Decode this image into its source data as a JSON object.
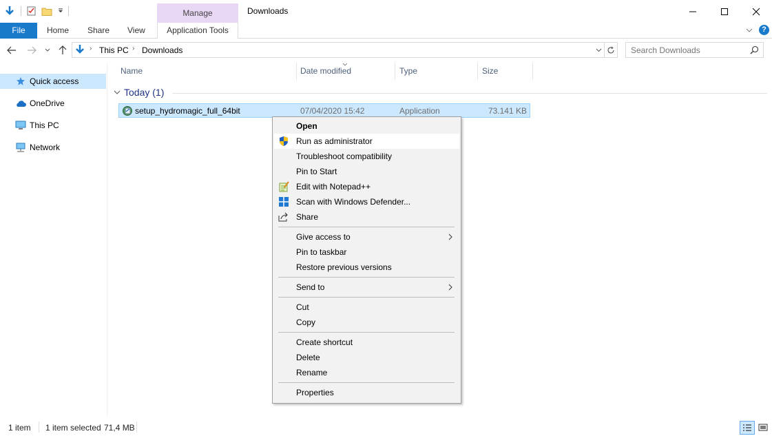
{
  "titlebar": {
    "manage_label": "Manage",
    "title": "Downloads",
    "minimize": "─",
    "maximize": "☐",
    "close": "✕"
  },
  "ribbon": {
    "file": "File",
    "home": "Home",
    "share": "Share",
    "view": "View",
    "app_tools": "Application Tools",
    "help": "?"
  },
  "address": {
    "crumbs": [
      "This PC",
      "Downloads"
    ],
    "search_placeholder": "Search Downloads"
  },
  "nav": {
    "items": [
      {
        "label": "Quick access",
        "icon": "star-icon"
      },
      {
        "label": "OneDrive",
        "icon": "cloud-icon"
      },
      {
        "label": "This PC",
        "icon": "computer-icon"
      },
      {
        "label": "Network",
        "icon": "network-icon"
      }
    ]
  },
  "columns": [
    "Name",
    "Date modified",
    "Type",
    "Size"
  ],
  "group": {
    "label": "Today (1)"
  },
  "file": {
    "name": "setup_hydromagic_full_64bit",
    "date": "07/04/2020 15:42",
    "type": "Application",
    "size": "73.141 KB"
  },
  "context_menu": {
    "items": [
      {
        "label": "Open",
        "bold": true
      },
      {
        "label": "Run as administrator",
        "icon": "uac-shield-icon",
        "highlighted": true
      },
      {
        "label": "Troubleshoot compatibility"
      },
      {
        "label": "Pin to Start"
      },
      {
        "label": "Edit with Notepad++",
        "icon": "notepad-plus-plus-icon"
      },
      {
        "label": "Scan with Windows Defender...",
        "icon": "windows-defender-icon"
      },
      {
        "label": "Share",
        "icon": "share-icon"
      },
      {
        "label": "Give access to",
        "submenu": true
      },
      {
        "label": "Pin to taskbar"
      },
      {
        "label": "Restore previous versions"
      },
      {
        "label": "Send to",
        "submenu": true
      },
      {
        "label": "Cut"
      },
      {
        "label": "Copy"
      },
      {
        "label": "Create shortcut"
      },
      {
        "label": "Delete"
      },
      {
        "label": "Rename"
      },
      {
        "label": "Properties"
      }
    ]
  },
  "status": {
    "count": "1 item",
    "selected": "1 item selected",
    "size": "71,4 MB"
  },
  "colors": {
    "accent": "#1979ca",
    "selection": "#cce8ff",
    "manage_tab": "#e9d7f6",
    "group_text": "#1e3287"
  }
}
